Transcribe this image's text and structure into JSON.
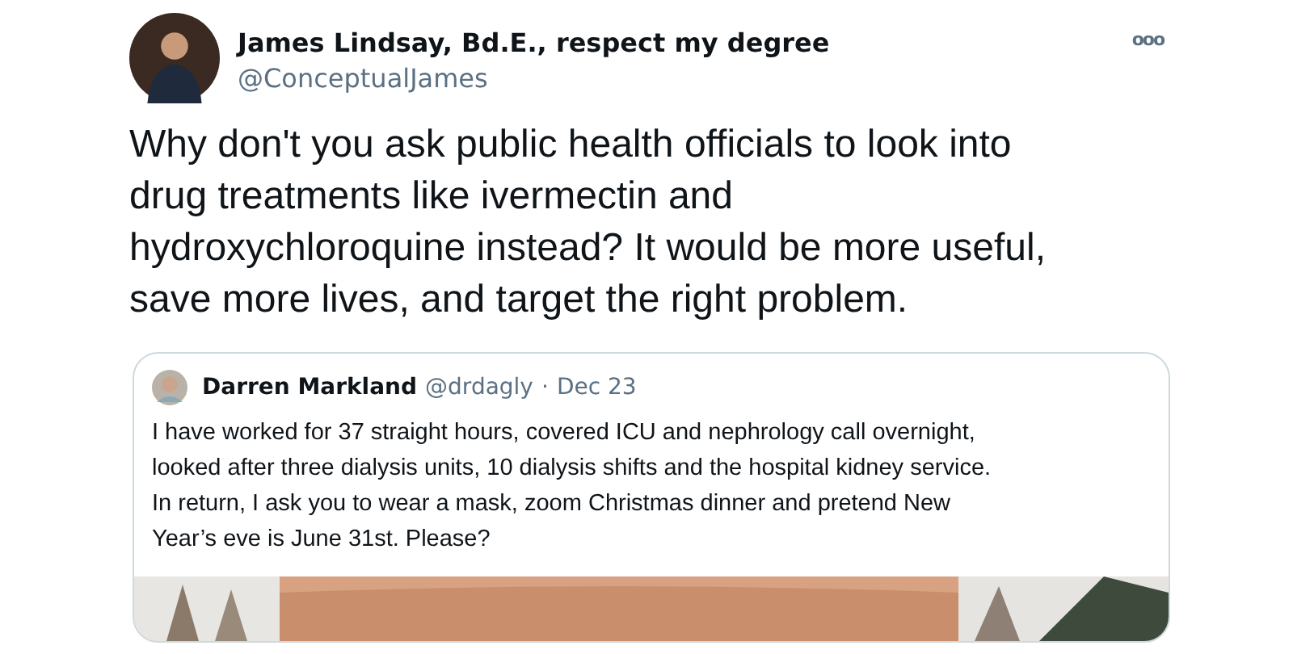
{
  "tweet": {
    "author": {
      "name": "James Lindsay, Bd.E., respect my degree",
      "handle": "@ConceptualJames"
    },
    "more_icon": "ooo",
    "text_lines": [
      "Why don't you ask public health officials to look into",
      "drug treatments like ivermectin and",
      "hydroxychloroquine instead? It would be more useful,",
      "save more lives, and target the right problem."
    ],
    "quoted": {
      "name": "Darren Markland",
      "handle": "@drdagly",
      "separator": "·",
      "date": "Dec 23",
      "text_lines": [
        "I have worked for 37 straight hours, covered ICU and nephrology call overnight,",
        "looked after three dialysis units, 10 dialysis shifts and the hospital kidney service.",
        "In return, I ask you to wear a mask, zoom Christmas dinner and pretend New",
        "Year’s eve is June 31st. Please?"
      ]
    }
  }
}
